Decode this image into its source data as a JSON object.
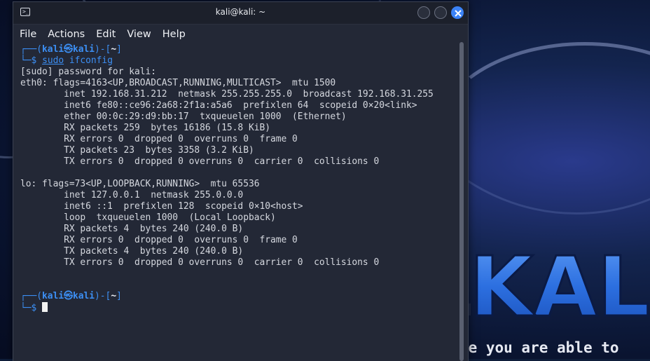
{
  "desktop": {
    "logo_text": "KALI LINUX",
    "tagline": "\"the quieter you become, the more you are able to"
  },
  "window": {
    "title": "kali@kali: ~",
    "menu": [
      "File",
      "Actions",
      "Edit",
      "View",
      "Help"
    ]
  },
  "terminal": {
    "prompt1": {
      "top_left": "┌──(",
      "user": "kali㉿kali",
      "mid": ")-[",
      "path": "~",
      "end": "]",
      "bottom": "└─",
      "dollar": "$ ",
      "cmd_sudo": "sudo",
      "cmd_rest": " ifconfig"
    },
    "output": [
      "[sudo] password for kali:",
      "eth0: flags=4163<UP,BROADCAST,RUNNING,MULTICAST>  mtu 1500",
      "        inet 192.168.31.212  netmask 255.255.255.0  broadcast 192.168.31.255",
      "        inet6 fe80::ce96:2a68:2f1a:a5a6  prefixlen 64  scopeid 0×20<link>",
      "        ether 00:0c:29:d9:bb:17  txqueuelen 1000  (Ethernet)",
      "        RX packets 259  bytes 16186 (15.8 KiB)",
      "        RX errors 0  dropped 0  overruns 0  frame 0",
      "        TX packets 23  bytes 3358 (3.2 KiB)",
      "        TX errors 0  dropped 0 overruns 0  carrier 0  collisions 0",
      "",
      "lo: flags=73<UP,LOOPBACK,RUNNING>  mtu 65536",
      "        inet 127.0.0.1  netmask 255.0.0.0",
      "        inet6 ::1  prefixlen 128  scopeid 0×10<host>",
      "        loop  txqueuelen 1000  (Local Loopback)",
      "        RX packets 4  bytes 240 (240.0 B)",
      "        RX errors 0  dropped 0  overruns 0  frame 0",
      "        TX packets 4  bytes 240 (240.0 B)",
      "        TX errors 0  dropped 0 overruns 0  carrier 0  collisions 0"
    ],
    "prompt2": {
      "top_left": "┌──(",
      "user": "kali㉿kali",
      "mid": ")-[",
      "path": "~",
      "end": "]",
      "bottom": "└─",
      "dollar": "$ "
    }
  },
  "colors": {
    "prompt_blue": "#3c8ff4",
    "close_button": "#3b82f6",
    "terminal_bg": "#232836"
  },
  "icons": {
    "app": "terminal-icon",
    "close": "close-icon"
  }
}
